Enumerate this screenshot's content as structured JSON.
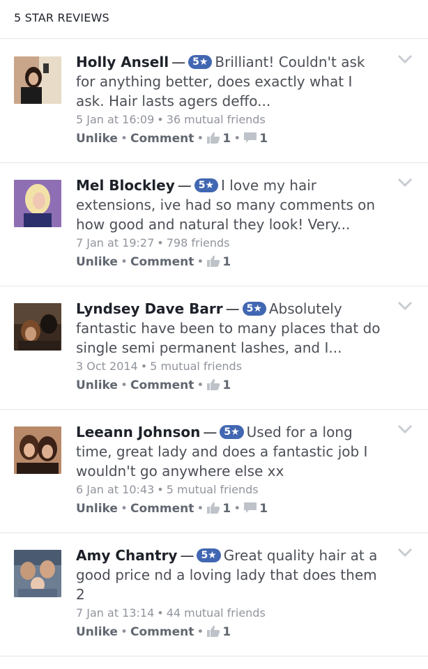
{
  "header": {
    "title": "5 STAR REVIEWS"
  },
  "badge_label": "5★",
  "dash": "—",
  "separator": "•",
  "actions": {
    "unlike": "Unlike",
    "comment": "Comment"
  },
  "colors": {
    "badge": "#4267b2",
    "meta": "#90949c",
    "divider": "#e5e6e9"
  },
  "icons": {
    "like": "thumbs-up-icon",
    "comment": "comment-icon",
    "menu": "chevron-down-icon"
  },
  "reviews": [
    {
      "name": "Holly Ansell",
      "text": "Brilliant! Couldn't ask for anything better, does exactly what I ask. Hair lasts agers deffo...",
      "date": "5 Jan at 16:09",
      "friends": "36 mutual friends",
      "likes": "1",
      "comments": "1"
    },
    {
      "name": "Mel Blockley",
      "text": "I love my hair extensions, ive had so many comments on how good and natural they look! Very...",
      "date": "7 Jan at 19:27",
      "friends": "798 friends",
      "likes": "1",
      "comments": ""
    },
    {
      "name": "Lyndsey Dave Barr",
      "text": "Absolutely fantastic have been to many places that do single semi permanent lashes, and I...",
      "date": "3 Oct 2014",
      "friends": "5 mutual friends",
      "likes": "1",
      "comments": ""
    },
    {
      "name": "Leeann Johnson",
      "text": "Used for a long time, great lady and does a fantastic job I wouldn't go anywhere else xx",
      "date": "6 Jan at 10:43",
      "friends": "5 mutual friends",
      "likes": "1",
      "comments": "1"
    },
    {
      "name": "Amy Chantry",
      "text": "Great quality hair at a good price nd a loving lady that does them 2",
      "date": "7 Jan at 13:14",
      "friends": "44 mutual friends",
      "likes": "1",
      "comments": ""
    }
  ]
}
